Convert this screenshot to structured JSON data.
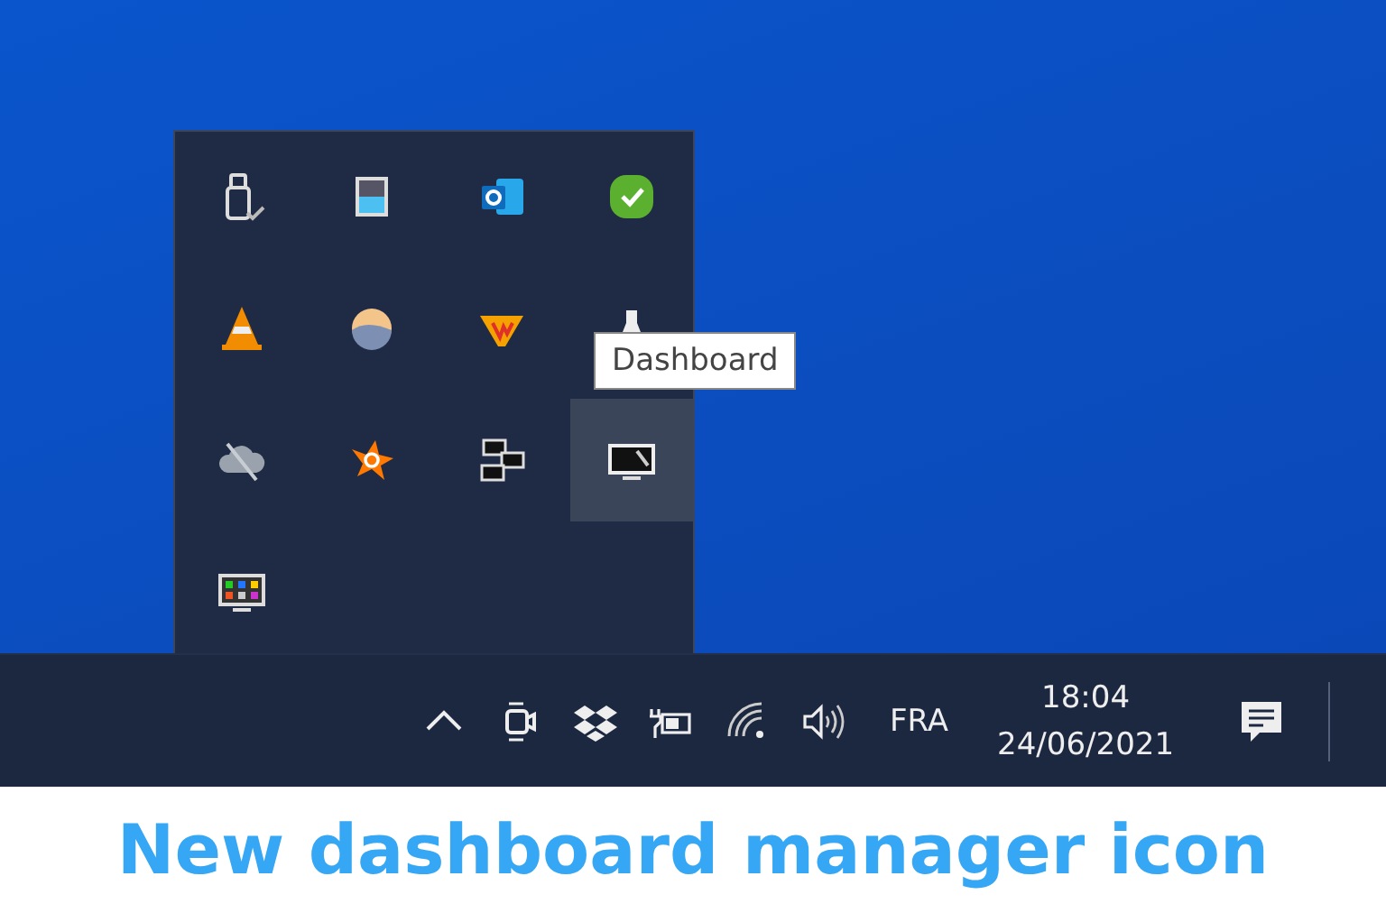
{
  "tray_overflow": {
    "items": [
      {
        "kind": "usb",
        "hovered": false
      },
      {
        "kind": "storage",
        "hovered": false
      },
      {
        "kind": "outlook",
        "hovered": false
      },
      {
        "kind": "check",
        "hovered": false
      },
      {
        "kind": "cone",
        "hovered": false
      },
      {
        "kind": "sphere",
        "hovered": false
      },
      {
        "kind": "w",
        "hovered": false
      },
      {
        "kind": "flask",
        "hovered": false
      },
      {
        "kind": "cloud",
        "hovered": false
      },
      {
        "kind": "avast",
        "hovered": false
      },
      {
        "kind": "network",
        "hovered": false
      },
      {
        "kind": "display",
        "hovered": true
      },
      {
        "kind": "grid-monitor",
        "hovered": false
      }
    ],
    "tooltip": "Dashboard"
  },
  "taskbar": {
    "tray_icons": [
      {
        "kind": "chevron"
      },
      {
        "kind": "camera"
      },
      {
        "kind": "dropbox"
      },
      {
        "kind": "battery"
      },
      {
        "kind": "wifi"
      },
      {
        "kind": "volume"
      }
    ],
    "language": "FRA",
    "time": "18:04",
    "date": "24/06/2021"
  },
  "caption": "New dashboard manager icon"
}
